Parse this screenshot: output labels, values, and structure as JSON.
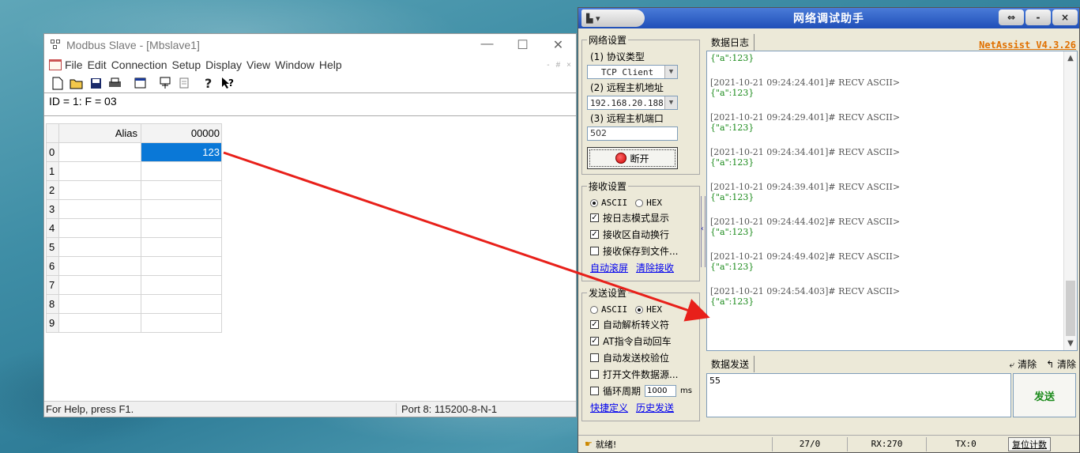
{
  "modbus": {
    "title": "Modbus Slave - [Mbslave1]",
    "win_min": "—",
    "win_max": "☐",
    "win_close": "✕",
    "menus": [
      "File",
      "Edit",
      "Connection",
      "Setup",
      "Display",
      "View",
      "Window",
      "Help"
    ],
    "mdi_min": "-",
    "mdi_restore": "#",
    "mdi_close": "×",
    "id_line": "ID = 1: F = 03",
    "grid": {
      "col_alias": "Alias",
      "col_value": "00000",
      "rows": [
        "0",
        "1",
        "2",
        "3",
        "4",
        "5",
        "6",
        "7",
        "8",
        "9"
      ],
      "row0_value": "123"
    },
    "status_left": "For Help, press F1.",
    "status_right": "Port 8: 115200-8-N-1"
  },
  "netassist": {
    "title": "网络调试助手",
    "win_pin": "⇔",
    "win_min": "-",
    "win_close": "×",
    "net": {
      "legend": "网络设置",
      "protocol_label": "(1) 协议类型",
      "protocol_value": "TCP Client",
      "host_label": "(2) 远程主机地址",
      "host_value": "192.168.20.188",
      "port_label": "(3) 远程主机端口",
      "port_value": "502",
      "disconnect_label": "断开"
    },
    "recv": {
      "legend": "接收设置",
      "ascii": "ASCII",
      "hex": "HEX",
      "opt1": "按日志模式显示",
      "opt2": "接收区自动换行",
      "opt3": "接收保存到文件...",
      "link1": "自动滚屏",
      "link2": "清除接收"
    },
    "send": {
      "legend": "发送设置",
      "ascii": "ASCII",
      "hex": "HEX",
      "opt1": "自动解析转义符",
      "opt2": "AT指令自动回车",
      "opt3": "自动发送校验位",
      "opt4": "打开文件数据源...",
      "opt5": "循环周期",
      "period": "1000",
      "period_unit": "ms",
      "link1": "快捷定义",
      "link2": "历史发送"
    },
    "log": {
      "tab": "数据日志",
      "version": "NetAssist V4.3.26",
      "first_msg": "{\"a\":123}",
      "entries": [
        {
          "hdr": "[2021-10-21 09:24:24.401]# RECV ASCII>",
          "msg": "{\"a\":123}"
        },
        {
          "hdr": "[2021-10-21 09:24:29.401]# RECV ASCII>",
          "msg": "{\"a\":123}"
        },
        {
          "hdr": "[2021-10-21 09:24:34.401]# RECV ASCII>",
          "msg": "{\"a\":123}"
        },
        {
          "hdr": "[2021-10-21 09:24:39.401]# RECV ASCII>",
          "msg": "{\"a\":123}"
        },
        {
          "hdr": "[2021-10-21 09:24:44.402]# RECV ASCII>",
          "msg": "{\"a\":123}"
        },
        {
          "hdr": "[2021-10-21 09:24:49.402]# RECV ASCII>",
          "msg": "{\"a\":123}"
        },
        {
          "hdr": "[2021-10-21 09:24:54.403]# RECV ASCII>",
          "msg": "{\"a\":123}"
        }
      ]
    },
    "send_area": {
      "tab": "数据发送",
      "clear1": "清除",
      "clear2": "清除",
      "value": "55",
      "send_btn": "发送"
    },
    "status": {
      "ready": "就绪!",
      "count": "27/0",
      "rx": "RX:270",
      "tx": "TX:0",
      "reset": "复位计数"
    }
  },
  "colors": {
    "selection": "#0a78d7",
    "arrow": "#e8201a",
    "log_msg": "#1a8a1a",
    "version": "#e07000"
  }
}
